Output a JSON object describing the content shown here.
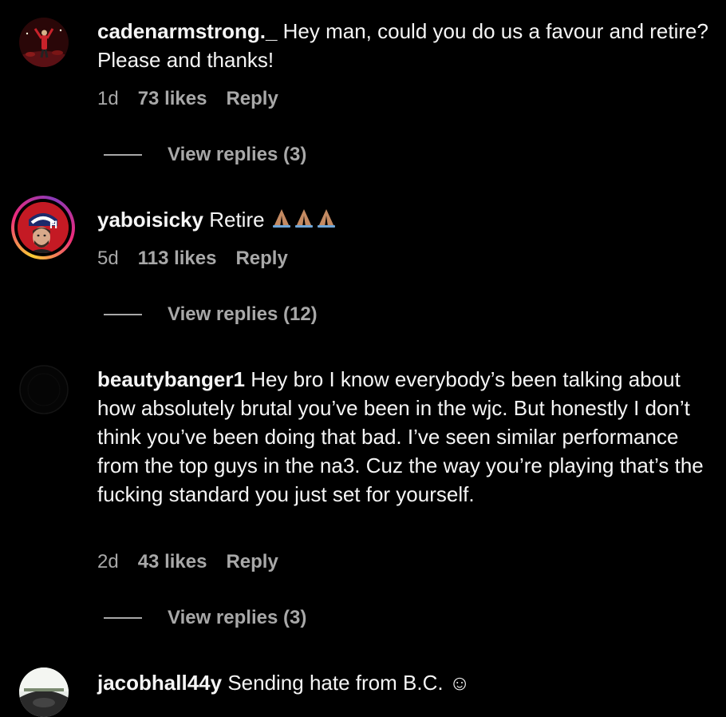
{
  "comments": [
    {
      "username": "cadenarmstrong._",
      "text": "Hey man, could you do us a favour and retire? Please and thanks!",
      "age": "1d",
      "likes": "73 likes",
      "reply": "Reply",
      "view_replies": "View replies (3)"
    },
    {
      "username": "yaboisicky",
      "text": "Retire",
      "emoji": "🙏🏽🙏🏽🙏🏽",
      "age": "5d",
      "likes": "113 likes",
      "reply": "Reply",
      "view_replies": "View replies (12)"
    },
    {
      "username": "beautybanger1",
      "text": "Hey bro I know everybody’s been talking about how absolutely brutal you’ve been in the wjc. But honestly I don’t think you’ve been doing that bad. I’ve seen similar performance from the top guys in the na3. Cuz the way you’re playing that’s the fucking standard you just set for yourself.",
      "age": "2d",
      "likes": "43 likes",
      "reply": "Reply",
      "view_replies": "View replies (3)"
    },
    {
      "username": "jacobhall44y",
      "text": "Sending hate from B.C.",
      "emoji": "☺"
    }
  ],
  "colors": {
    "background": "#000000",
    "primary_text": "#f5f5f5",
    "secondary_text": "#a8a8a8",
    "story_ring": [
      "#f9ce34",
      "#ee2a7b",
      "#8a3ab9"
    ]
  }
}
